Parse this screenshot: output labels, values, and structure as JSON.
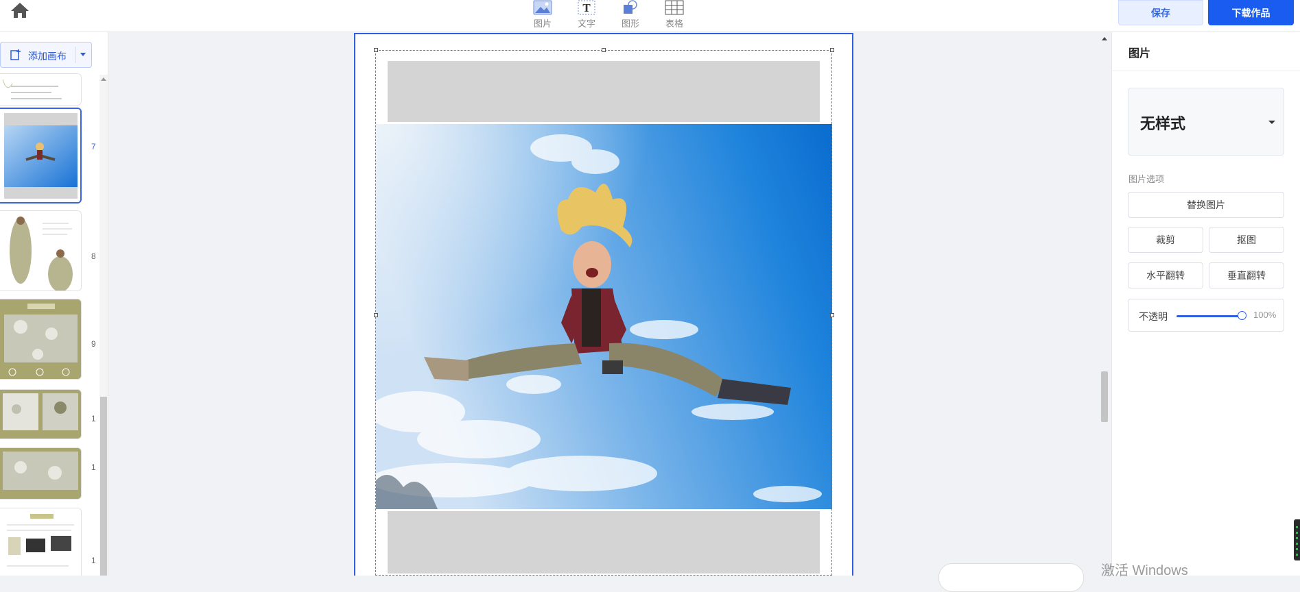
{
  "toolbar": {
    "tools": [
      {
        "label": "图片",
        "icon": "image-icon"
      },
      {
        "label": "文字",
        "icon": "text-icon"
      },
      {
        "label": "图形",
        "icon": "shape-icon"
      },
      {
        "label": "表格",
        "icon": "table-icon"
      }
    ],
    "save_label": "保存",
    "download_label": "下载作品",
    "accent_color": "#1a5bf0"
  },
  "left_panel": {
    "add_canvas_label": "添加画布",
    "page_numbers": [
      "7",
      "8",
      "9",
      "1",
      "1",
      "1"
    ],
    "selected_page": "7"
  },
  "right_panel": {
    "title": "图片",
    "style_value": "无样式",
    "section_label": "图片选项",
    "replace_label": "替换图片",
    "crop_label": "裁剪",
    "cutout_label": "抠图",
    "flip_h_label": "水平翻转",
    "flip_v_label": "垂直翻转",
    "opacity_label": "不透明",
    "opacity_value": "100%",
    "opacity_fraction": 1.0
  },
  "watermark": "激活 Windows"
}
